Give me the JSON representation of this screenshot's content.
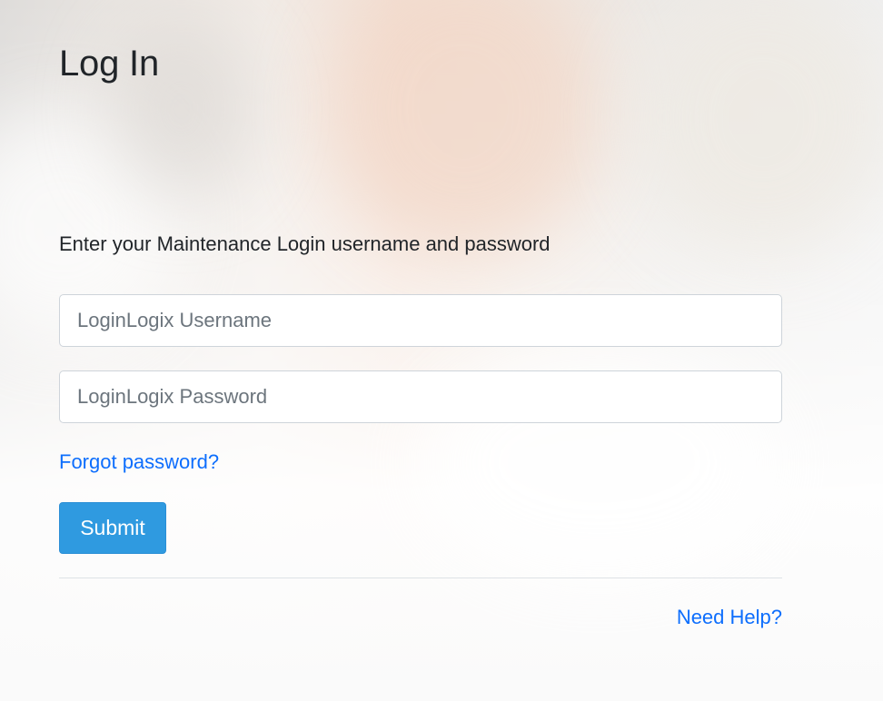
{
  "page": {
    "title": "Log In",
    "instructions": "Enter your Maintenance Login username and password"
  },
  "form": {
    "username": {
      "value": "",
      "placeholder": "LoginLogix Username"
    },
    "password": {
      "value": "",
      "placeholder": "LoginLogix Password"
    },
    "forgot_link": "Forgot password?",
    "submit_label": "Submit"
  },
  "footer": {
    "help_link": "Need Help?"
  },
  "colors": {
    "link": "#0d6efd",
    "submit_button": "#2f9ae0",
    "text": "#212529"
  }
}
